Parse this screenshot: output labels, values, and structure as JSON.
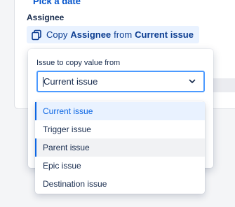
{
  "background": {
    "pick_date_link": "Pick a date"
  },
  "field": {
    "label": "Assignee",
    "copy_action": {
      "prefix": "Copy",
      "field_name": "Assignee",
      "middle": "from",
      "source": "Current issue",
      "icon": "copy-icon"
    }
  },
  "popup": {
    "label": "Issue to copy value from",
    "select": {
      "value": "Current issue",
      "icon": "chevron-down-icon"
    }
  },
  "dropdown": {
    "options": [
      {
        "label": "Current issue",
        "state": "selected"
      },
      {
        "label": "Trigger issue",
        "state": "normal"
      },
      {
        "label": "Parent issue",
        "state": "hover"
      },
      {
        "label": "Epic issue",
        "state": "normal"
      },
      {
        "label": "Destination issue",
        "state": "normal"
      }
    ]
  },
  "colors": {
    "accent": "#0c66e4",
    "focus_border": "#4c9aff",
    "selected_bg": "#e9f2ff",
    "hover_bg": "#f1f2f4"
  }
}
